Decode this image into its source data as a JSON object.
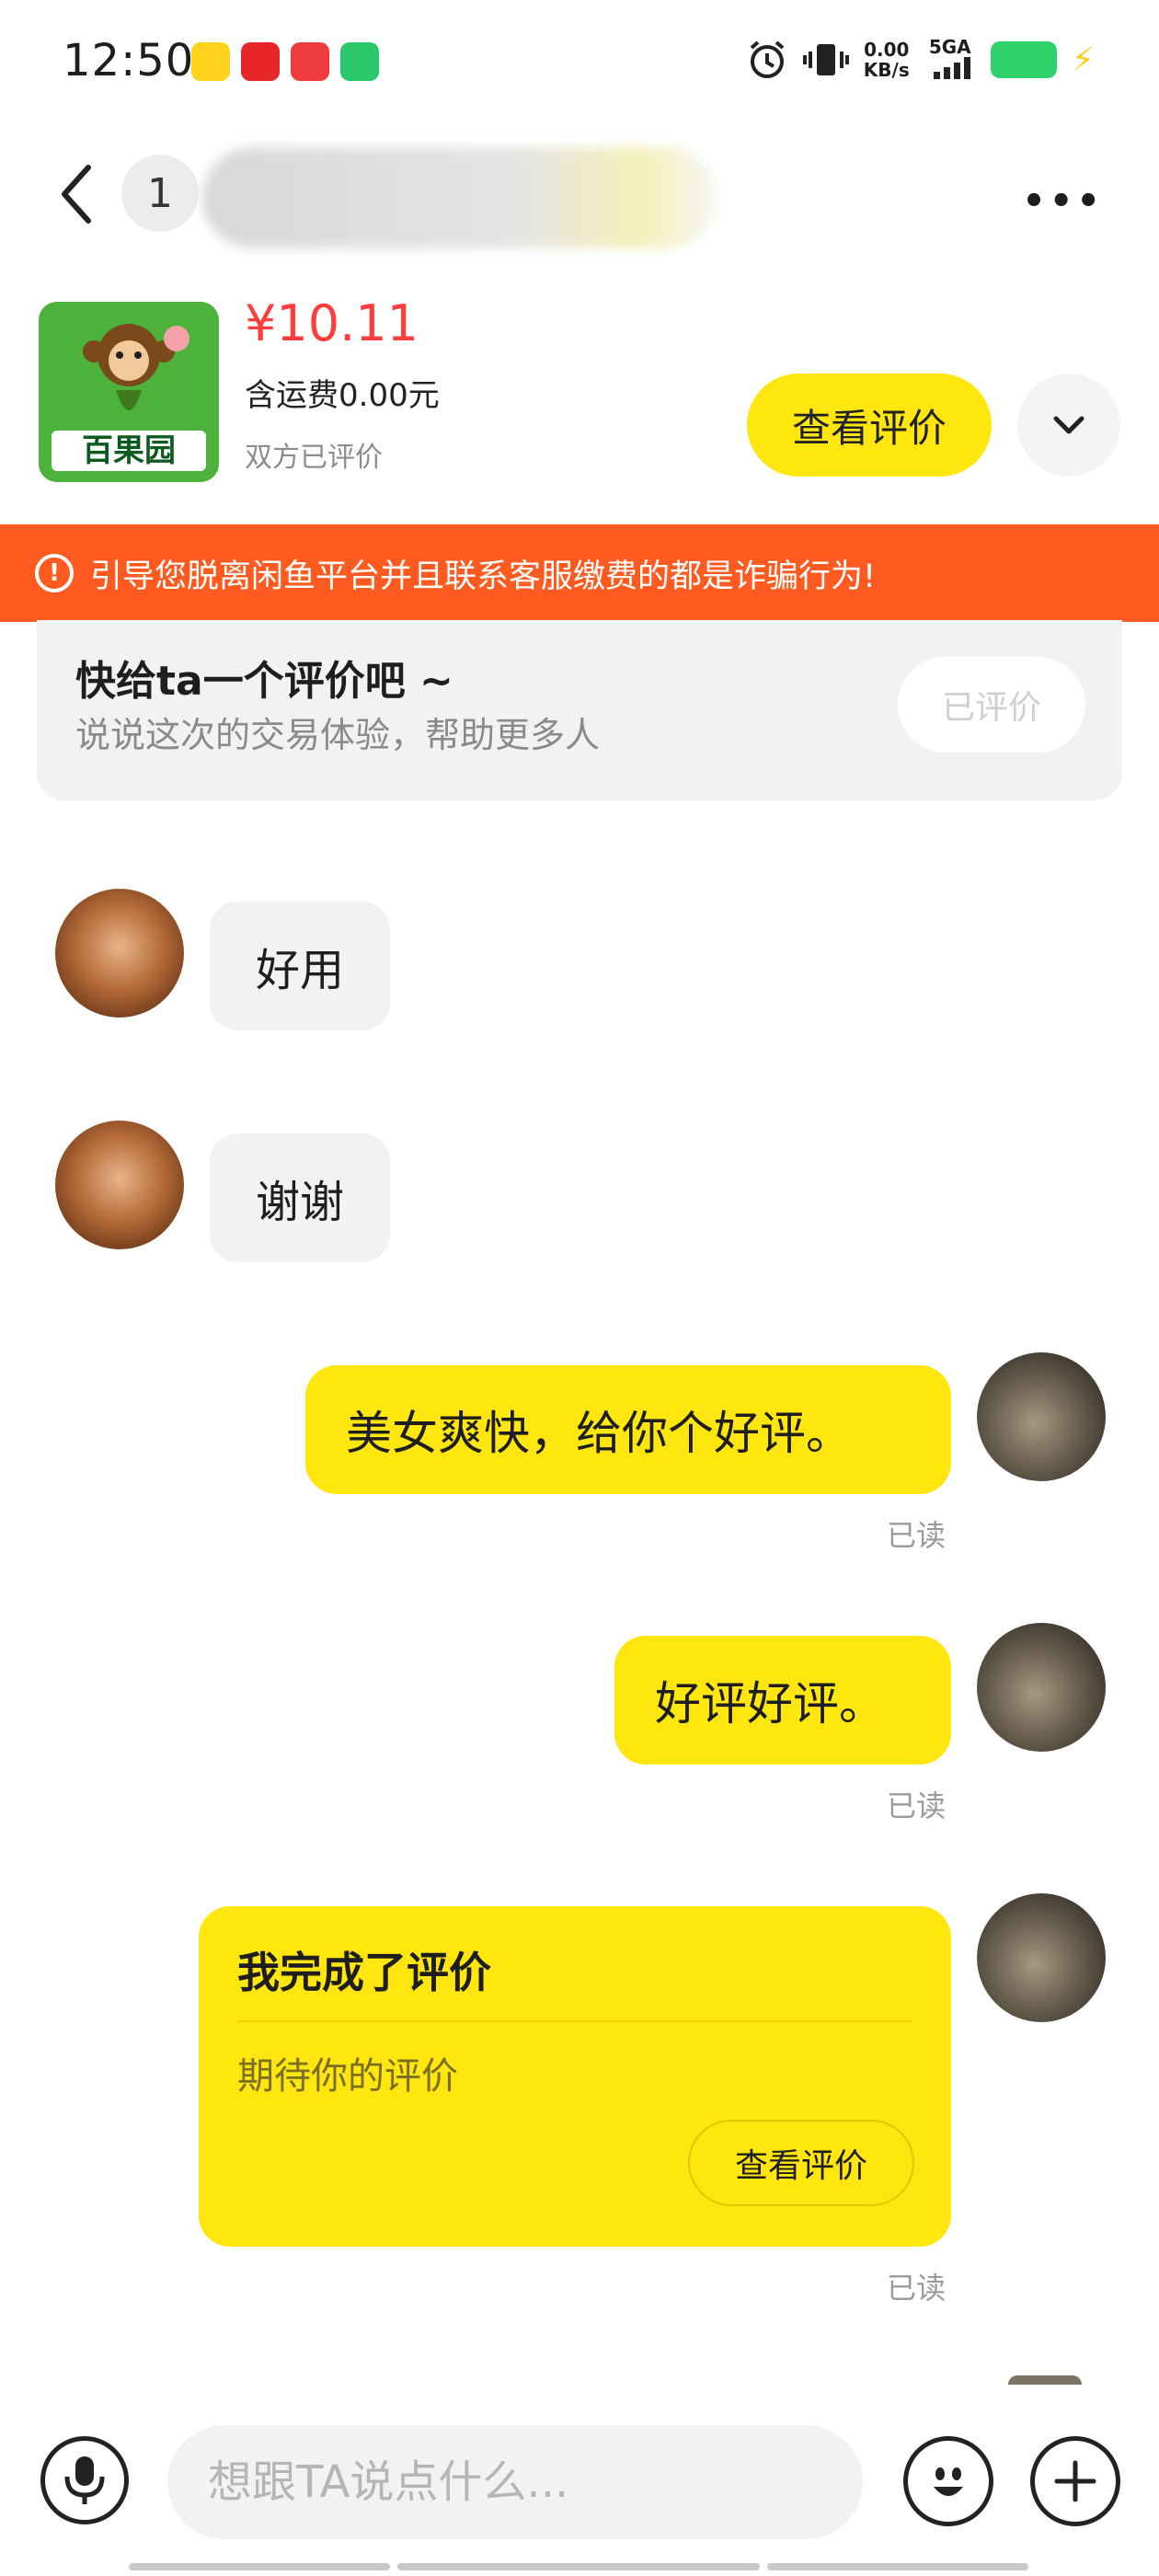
{
  "status_bar": {
    "time": "12:50",
    "net_speed_value": "0.00",
    "net_speed_unit": "KB/s",
    "network": "5GA"
  },
  "header": {
    "unread_count": "1",
    "more_label": "•••"
  },
  "product": {
    "price": "¥10.11",
    "shipping": "含运费0.00元",
    "review_status": "双方已评价",
    "thumb_label": "百果园",
    "view_review_label": "查看评价"
  },
  "warning": {
    "icon": "!",
    "text": "引导您脱离闲鱼平台并且联系客服缴费的都是诈骗行为!"
  },
  "review_prompt": {
    "title": "快给ta一个评价吧 ~",
    "subtitle": "说说这次的交易体验，帮助更多人",
    "button_label": "已评价"
  },
  "messages": [
    {
      "from": "other",
      "text": "好用"
    },
    {
      "from": "other",
      "text": "谢谢"
    },
    {
      "from": "me",
      "text": "美女爽快，给你个好评。",
      "status": "已读"
    },
    {
      "from": "me",
      "text": "好评好评。",
      "status": "已读"
    }
  ],
  "review_done_card": {
    "title": "我完成了评价",
    "subtitle": "期待你的评价",
    "button_label": "查看评价",
    "status": "已读"
  },
  "input_bar": {
    "placeholder": "想跟TA说点什么..."
  },
  "colors": {
    "accent_yellow": "#ffe60f",
    "warning_orange": "#ff5a1f",
    "price_red": "#ff3d3d",
    "bubble_gray": "#f2f2f4"
  },
  "icons": [
    "back-arrow-icon",
    "ellipsis-icon",
    "chevron-down-icon",
    "warning-circle-icon",
    "microphone-icon",
    "emoji-icon",
    "plus-icon",
    "battery-icon",
    "alarm-icon",
    "vibrate-icon",
    "signal-icon"
  ]
}
